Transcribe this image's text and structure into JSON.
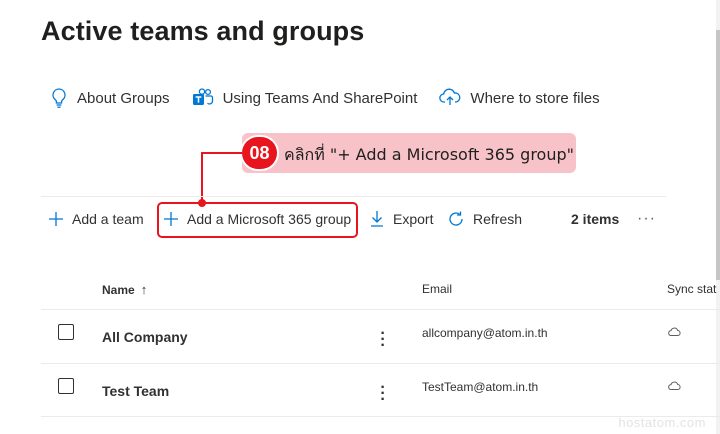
{
  "page": {
    "title": "Active teams and groups"
  },
  "links": [
    {
      "label": "About Groups",
      "icon": "lightbulb-icon"
    },
    {
      "label": "Using Teams And SharePoint",
      "icon": "teams-icon"
    },
    {
      "label": "Where to store files",
      "icon": "cloud-upload-icon"
    }
  ],
  "callout": {
    "step": "08",
    "text": "คลิกที่ \"+ Add a Microsoft 365 group\""
  },
  "toolbar": {
    "add_team": "Add a team",
    "add_group": "Add a Microsoft 365 group",
    "export": "Export",
    "refresh": "Refresh",
    "count": "2 items",
    "more": "···"
  },
  "table": {
    "columns": {
      "name": "Name",
      "sort_indicator": "↑",
      "email": "Email",
      "sync": "Sync stat"
    },
    "rows": [
      {
        "name": "All Company",
        "email": "allcompany@atom.in.th"
      },
      {
        "name": "Test Team",
        "email": "TestTeam@atom.in.th"
      }
    ]
  },
  "watermark": "hostatom.com",
  "colors": {
    "accent": "#0078d4",
    "annotation_red": "#e8141e",
    "callout_bg": "#f8c3c8"
  }
}
